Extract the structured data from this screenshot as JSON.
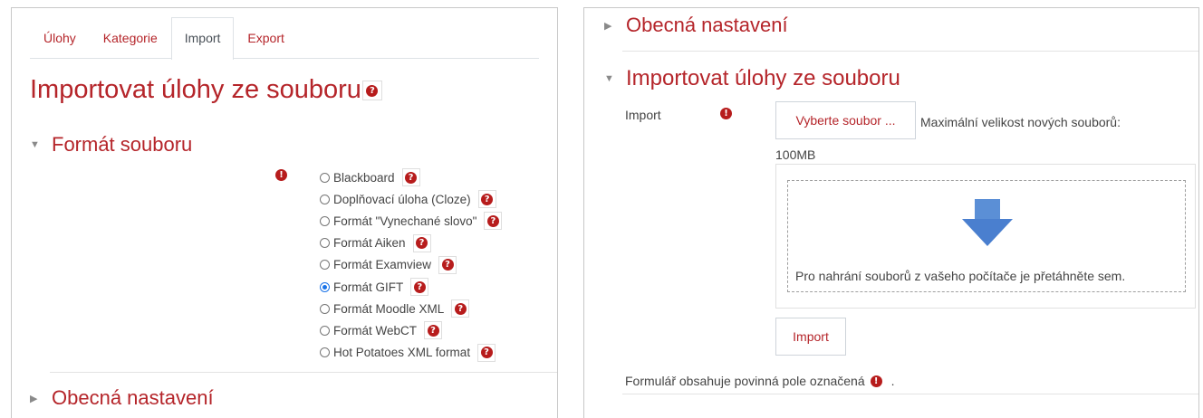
{
  "left": {
    "tabs": [
      {
        "label": "Úlohy",
        "active": false
      },
      {
        "label": "Kategorie",
        "active": false
      },
      {
        "label": "Import",
        "active": true
      },
      {
        "label": "Export",
        "active": false
      }
    ],
    "page_title": "Importovat úlohy ze souboru",
    "format_section_title": "Formát souboru",
    "formats": [
      {
        "label": "Blackboard",
        "checked": false
      },
      {
        "label": "Doplňovací úloha (Cloze)",
        "checked": false
      },
      {
        "label": "Formát \"Vynechané slovo\"",
        "checked": false
      },
      {
        "label": "Formát Aiken",
        "checked": false
      },
      {
        "label": "Formát Examview",
        "checked": false
      },
      {
        "label": "Formát GIFT",
        "checked": true
      },
      {
        "label": "Formát Moodle XML",
        "checked": false
      },
      {
        "label": "Formát WebCT",
        "checked": false
      },
      {
        "label": "Hot Potatoes XML format",
        "checked": false
      }
    ],
    "general_section_title": "Obecná nastavení"
  },
  "right": {
    "general_section_title": "Obecná nastavení",
    "import_section_title": "Importovat úlohy ze souboru",
    "import_label": "Import",
    "choose_file_label": "Vyberte soubor ...",
    "max_size_text": "Maximální velikost nových souborů:",
    "max_size_value": "100MB",
    "dropzone_text": "Pro nahrání souborů z vašeho počítače je přetáhněte sem.",
    "submit_label": "Import",
    "required_note": "Formulář obsahuje povinná pole označená",
    "required_note_suffix": "."
  },
  "colors": {
    "accent": "#b5252a",
    "required": "#b71c1c",
    "arrow": "#5b8fd6",
    "radio_checked": "#1a73e8"
  },
  "icons": {
    "help": "question-circle-icon",
    "required": "exclamation-circle-icon",
    "caret_down": "caret-down-icon",
    "caret_right": "caret-right-icon",
    "upload_arrow": "down-arrow-icon"
  }
}
